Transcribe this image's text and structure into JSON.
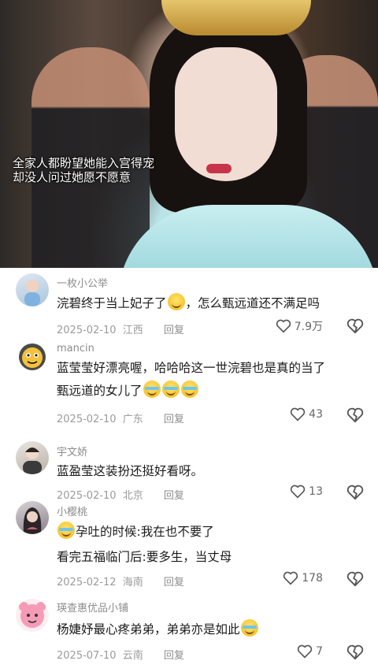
{
  "video": {
    "caption_line1": "全家人都盼望她能入宫得宠",
    "caption_line2": "却没人问过她愿不愿意"
  },
  "comments": [
    {
      "username": "一枚小公举",
      "text_before": "浣碧终于当上妃子了",
      "text_after": "，怎么甄远道还不满足吗",
      "date": "2025-02-10",
      "location": "江西",
      "reply": "回复",
      "likes": "7.9万"
    },
    {
      "username": "mancin",
      "line1": "蓝莹莹好漂亮喔，哈哈哈这一世浣碧也是真的当了",
      "line2": "甄远道的女儿了",
      "date": "2025-02-10",
      "location": "广东",
      "reply": "回复",
      "likes": "43"
    },
    {
      "username": "宇文娇",
      "text": "蓝盈莹这装扮还挺好看呀。",
      "date": "2025-02-10",
      "location": "北京",
      "reply": "回复",
      "likes": "13"
    },
    {
      "username": "小樱桃",
      "line1": "孕吐的时候:我在也不要了",
      "line2": "看完五福临门后:要多生，当丈母",
      "date": "2025-02-12",
      "location": "海南",
      "reply": "回复",
      "likes": "178"
    },
    {
      "username": "瑛查惠优品小铺",
      "text": "杨婕妤最心疼弟弟，弟弟亦是如此",
      "date": "2025-07-10",
      "location": "云南",
      "reply": "回复",
      "likes": "7"
    }
  ],
  "icons": {
    "like": "heart-outline-icon",
    "dislike": "broken-heart-icon"
  },
  "colors": {
    "meta": "#9b9b9b",
    "username": "#8c8c8c"
  }
}
